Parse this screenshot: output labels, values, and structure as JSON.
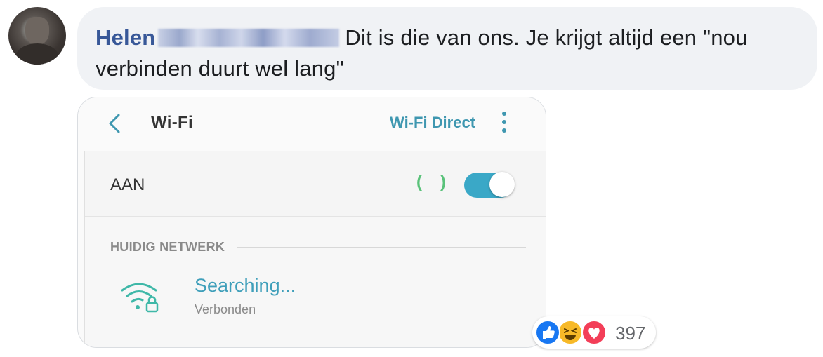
{
  "comment": {
    "author": "Helen",
    "text": "Dit is die van ons. Je krijgt altijd een \"nou verbinden duurt wel lang\""
  },
  "screenshot": {
    "header": {
      "title": "Wi-Fi",
      "direct_label": "Wi-Fi Direct"
    },
    "toggle_row": {
      "label": "AAN",
      "signal_left": "(",
      "signal_right": ")",
      "state": "on"
    },
    "section": {
      "label": "HUIDIG NETWERK"
    },
    "network": {
      "name": "Searching...",
      "status": "Verbonden"
    }
  },
  "reactions": {
    "icons": [
      "like-icon",
      "haha-icon",
      "love-icon"
    ],
    "count": "397"
  },
  "colors": {
    "author": "#385898",
    "bubble": "#f0f2f5",
    "accent": "#3aa8c7",
    "like": "#1877f2",
    "haha": "#f7b928",
    "love": "#f33e58"
  }
}
